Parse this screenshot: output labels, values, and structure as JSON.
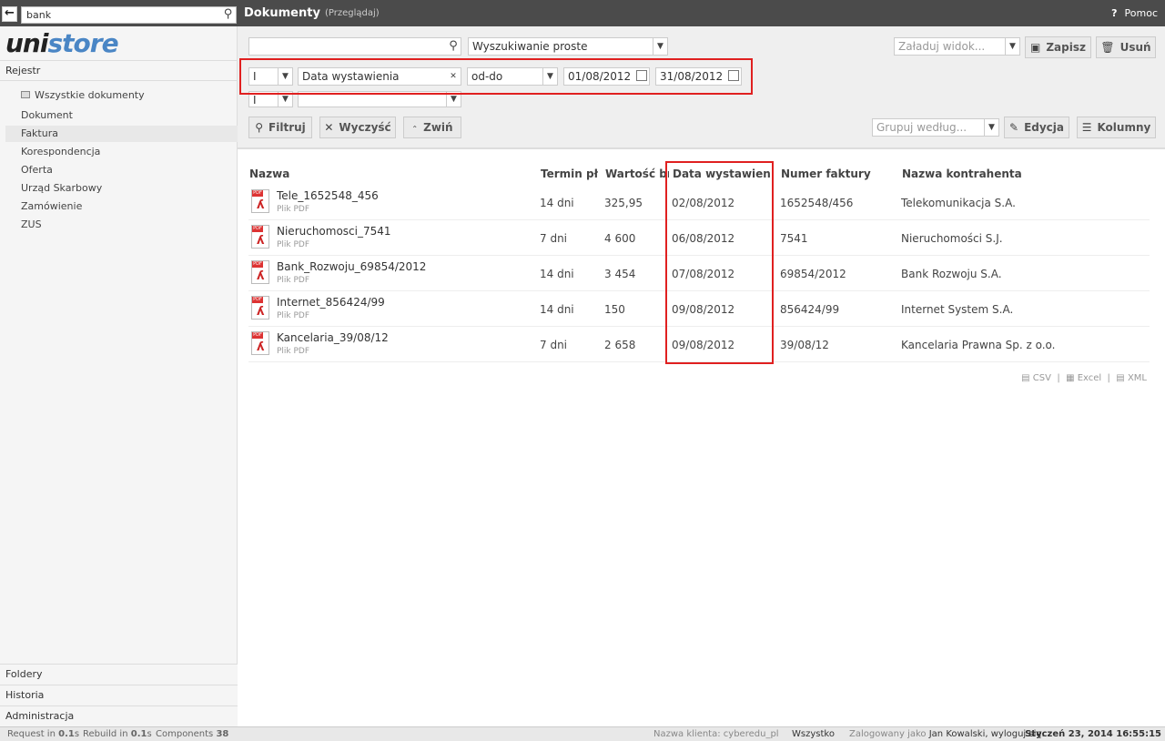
{
  "header": {
    "search_value": "bank",
    "title": "Dokumenty",
    "subtitle": "(Przeglądaj)",
    "help_label": "Pomoc"
  },
  "sidebar": {
    "logo_part1": "uni",
    "logo_part2": "store",
    "section": "Rejestr",
    "items": [
      "Wszystkie dokumenty",
      "Dokument",
      "Faktura",
      "Korespondencja",
      "Oferta",
      "Urząd Skarbowy",
      "Zamówienie",
      "ZUS"
    ],
    "active_item": "Faktura",
    "bottom_sections": [
      "Foldery",
      "Historia",
      "Administracja"
    ]
  },
  "filters": {
    "search_value": "",
    "search_mode": "Wyszukiwanie proste",
    "view_placeholder": "Załaduj widok...",
    "save_label": "Zapisz",
    "delete_label": "Usuń",
    "row1": {
      "op": "I",
      "field": "Data wystawienia",
      "mode": "od-do",
      "date_from": "01/08/2012",
      "date_to": "31/08/2012"
    },
    "row2": {
      "op": "I",
      "field": ""
    },
    "filter_label": "Filtruj",
    "clear_label": "Wyczyść",
    "collapse_label": "Zwiń",
    "group_placeholder": "Grupuj według...",
    "edit_label": "Edycja",
    "columns_label": "Kolumny"
  },
  "table": {
    "columns": [
      "Nazwa",
      "Termin płatności",
      "Wartość brutto",
      "Data wystawienia",
      "Numer faktury",
      "Nazwa kontrahenta"
    ],
    "rows": [
      {
        "name": "Tele_1652548_456",
        "type": "Plik PDF",
        "term": "14 dni",
        "value": "325,95",
        "date": "02/08/2012",
        "number": "1652548/456",
        "contractor": "Telekomunikacja S.A."
      },
      {
        "name": "Nieruchomosci_7541",
        "type": "Plik PDF",
        "term": "7 dni",
        "value": "4 600",
        "date": "06/08/2012",
        "number": "7541",
        "contractor": "Nieruchomości S.J."
      },
      {
        "name": "Bank_Rozwoju_69854/2012",
        "type": "Plik PDF",
        "term": "14 dni",
        "value": "3 454",
        "date": "07/08/2012",
        "number": "69854/2012",
        "contractor": "Bank Rozwoju S.A."
      },
      {
        "name": "Internet_856424/99",
        "type": "Plik PDF",
        "term": "14 dni",
        "value": "150",
        "date": "09/08/2012",
        "number": "856424/99",
        "contractor": "Internet System S.A."
      },
      {
        "name": "Kancelaria_39/08/12",
        "type": "Plik PDF",
        "term": "7 dni",
        "value": "2 658",
        "date": "09/08/2012",
        "number": "39/08/12",
        "contractor": "Kancelaria Prawna Sp. z o.o."
      }
    ],
    "exports": [
      "CSV",
      "Excel",
      "XML"
    ]
  },
  "status": {
    "request_label": "Request in",
    "request_time": "0.1",
    "rebuild_label": "Rebuild in",
    "rebuild_time": "0.1",
    "components_label": "Components",
    "components_count": "38",
    "client_label": "Nazwa klienta:",
    "client_value": "cyberedu_pl",
    "scope": "Wszystko",
    "logged_label": "Zalogowany jako",
    "user": "Jan Kowalski",
    "logout": ", wyloguj się.",
    "datetime": "Styczeń 23, 2014 16:55:15"
  }
}
